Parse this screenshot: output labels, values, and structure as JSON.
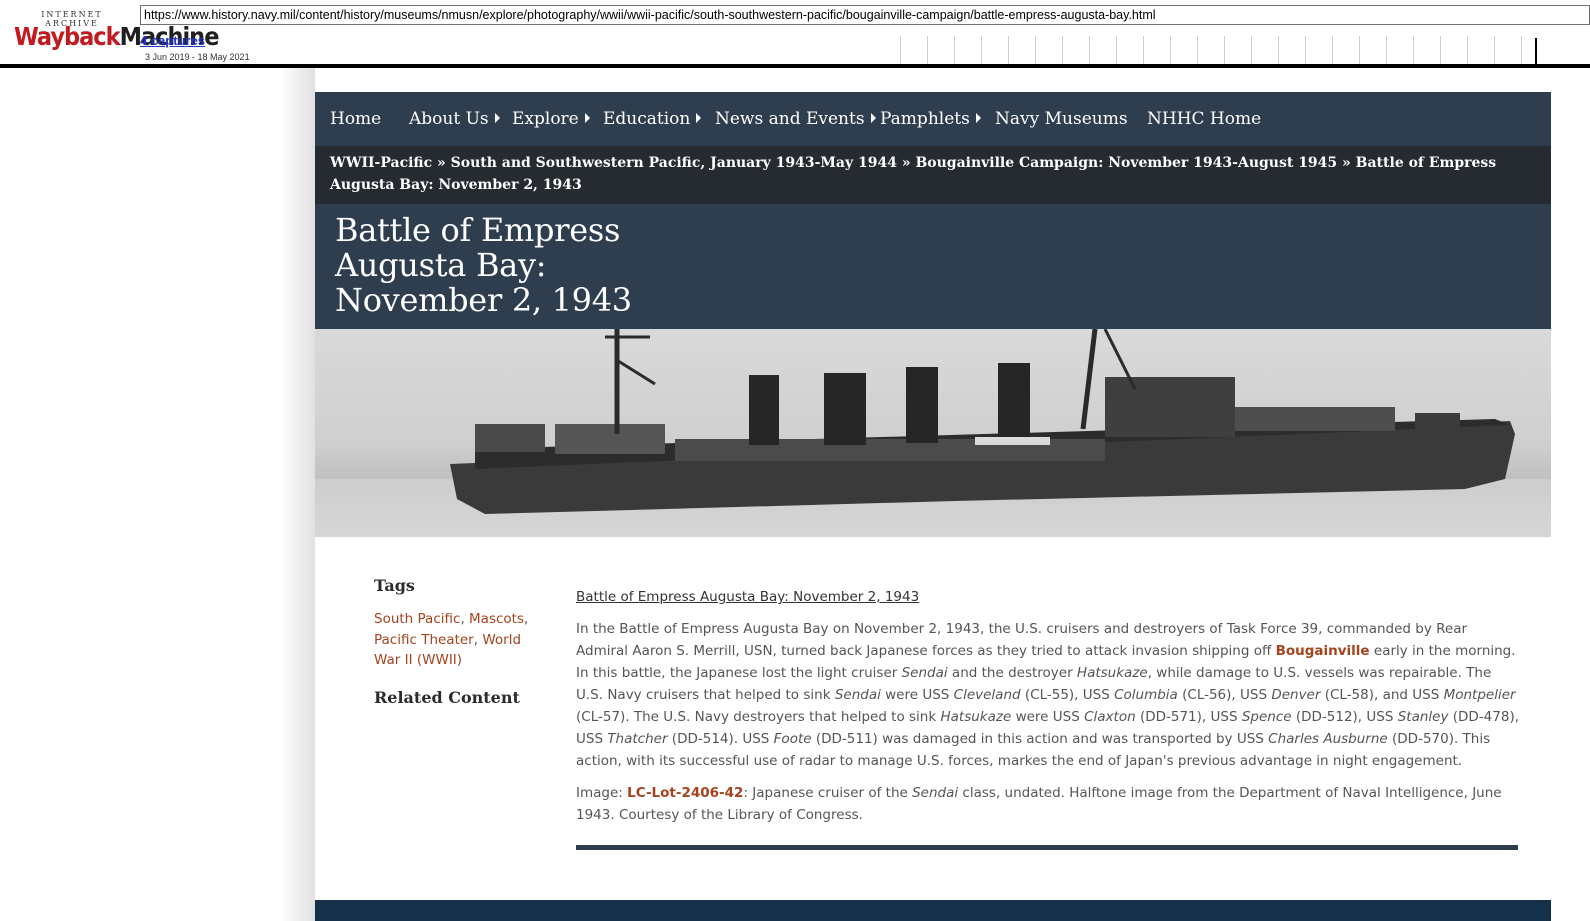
{
  "wayback": {
    "logo_small": "INTERNET ARCHIVE",
    "logo_part1": "Wayback",
    "logo_part2": "Machine",
    "url": "https://www.history.navy.mil/content/history/museums/nmusn/explore/photography/wwii/wwii-pacific/south-southwestern-pacific/bougainville-campaign/battle-empress-augusta-bay.html",
    "captures": "4 captures",
    "date_range": "3 Jun 2019 - 18 May 2021"
  },
  "nav": {
    "items": [
      {
        "label": "Home",
        "has_submenu": false
      },
      {
        "label": "About Us",
        "has_submenu": true
      },
      {
        "label": "Explore",
        "has_submenu": true
      },
      {
        "label": "Education",
        "has_submenu": true
      },
      {
        "label": "News and Events",
        "has_submenu": true
      },
      {
        "label": "Pamphlets",
        "has_submenu": true
      },
      {
        "label": "Navy Museums",
        "has_submenu": false
      },
      {
        "label": "NHHC Home",
        "has_submenu": false
      }
    ]
  },
  "breadcrumb": {
    "items": [
      "WWII-Pacific",
      "South and Southwestern Pacific, January 1943-May 1944",
      "Bougainville Campaign: November 1943-August 1945",
      "Battle of Empress Augusta Bay: November 2, 1943"
    ],
    "separator": "»"
  },
  "page": {
    "title": "Battle of Empress Augusta Bay: November 2, 1943"
  },
  "hero": {
    "icon": "photo-of-japanese-cruiser"
  },
  "sidebar": {
    "tags_heading": "Tags",
    "tags": [
      "South Pacific",
      "Mascots",
      "Pacific Theater",
      "World War II (WWII)"
    ],
    "related_heading": "Related Content"
  },
  "article": {
    "heading": "Battle of Empress Augusta Bay:  November 2, 1943",
    "p1": {
      "a": "In the Battle of Empress Augusta Bay on November 2, 1943, the U.S. cruisers and destroyers of Task Force 39, commanded by Rear Admiral Aaron S. Merrill, USN, turned back Japanese forces as they tried to attack invasion shipping off ",
      "link": "Bougainville",
      "b": " early in the morning. In this battle, the Japanese lost the light cruiser ",
      "sendai1": "Sendai",
      "c": " and the destroyer ",
      "hatsukaze1": "Hatsukaze",
      "d": ", while damage to U.S. vessels was repairable.   The U.S. Navy cruisers that helped to sink ",
      "sendai2": "Sendai",
      "e": " were USS ",
      "cleveland": "Cleveland",
      "f": " (CL-55), USS ",
      "columbia": "Columbia",
      "g": " (CL-56), USS ",
      "denver": "Denver",
      "h": " (CL-58), and USS ",
      "montpelier": "Montpelier",
      "i": " (CL-57).  The U.S. Navy destroyers that helped to sink ",
      "hatsukaze2": "Hatsukaze",
      "j": " were USS ",
      "claxton": "Claxton",
      "k": " (DD-571), USS ",
      "spence": "Spence",
      "l": " (DD-512), USS ",
      "stanley": "Stanley",
      "m": " (DD-478), USS ",
      "thatcher": "Thatcher",
      "n": " (DD-514).  USS ",
      "foote": "Foote",
      "o": " (DD-511) was damaged in this action and was transported by USS ",
      "ausburne": "Charles Ausburne",
      "p": " (DD-570).  This action, with its successful use of radar to manage U.S. forces, markes the end of Japan's previous advantage in night engagement."
    },
    "p2": {
      "a": "Image:  ",
      "link": "LC-Lot-2406-42",
      "b": ":  Japanese cruiser of the ",
      "sendai": "Sendai",
      "c": " class, undated.  Halftone image from the Department of Naval Intelligence, June 1943.   Courtesy of the Library of Congress."
    }
  },
  "colors": {
    "nav_bg": "#2e3e4f",
    "breadcrumb_bg": "#252b30",
    "link": "#a6431e",
    "footer": "#15314a"
  }
}
